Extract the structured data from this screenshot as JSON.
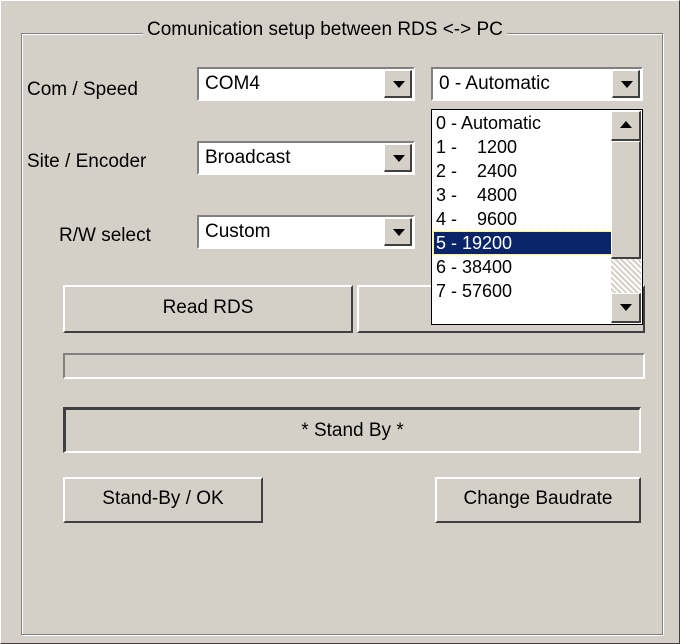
{
  "group_title": "Comunication setup between RDS <-> PC",
  "rows": {
    "com_speed": {
      "label": "Com / Speed",
      "port_value": "COM4",
      "speed_value": "0 - Automatic"
    },
    "site_encoder": {
      "label": "Site / Encoder",
      "value": "Broadcast"
    },
    "rw_select": {
      "label": "R/W select",
      "value": "Custom"
    }
  },
  "speed_options": [
    "0 - Automatic",
    "1 -    1200",
    "2 -    2400",
    "3 -    4800",
    "4 -    9600",
    "5 - 19200",
    "6 - 38400",
    "7 - 57600"
  ],
  "selected_speed_option": "5 - 19200",
  "buttons": {
    "read_rds": "Read RDS",
    "standby_ok": "Stand-By / OK",
    "change_baudrate": "Change Baudrate"
  },
  "status_text": "* Stand By *"
}
